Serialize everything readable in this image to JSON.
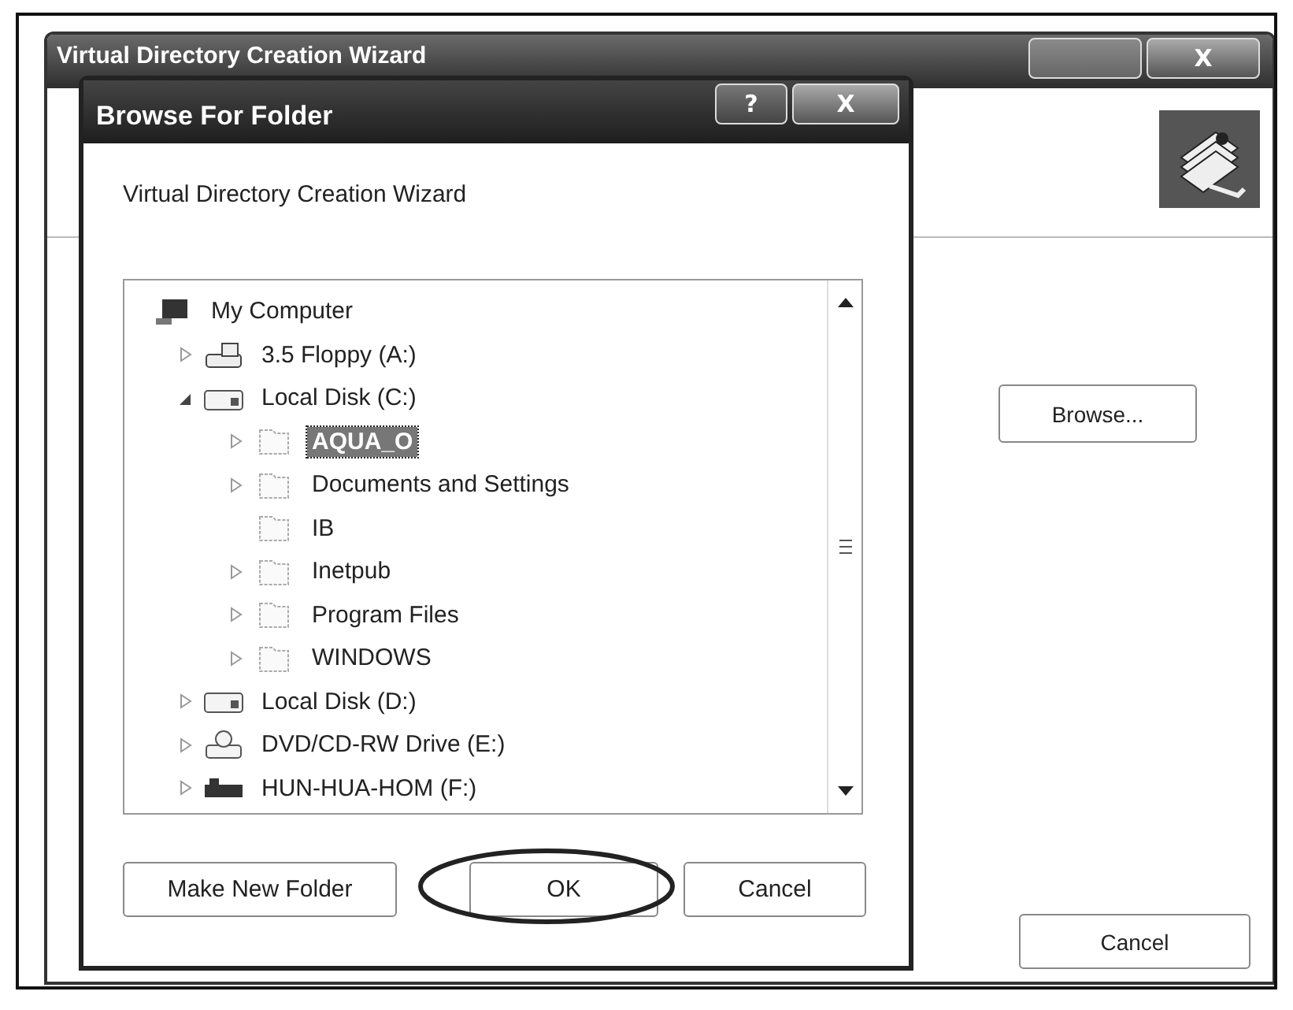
{
  "wizard": {
    "title": "Virtual Directory Creation Wizard",
    "title_buttons": [
      {
        "kind": "blank"
      },
      {
        "kind": "close",
        "label": "X"
      }
    ],
    "browse_button": "Browse...",
    "cancel_button": "Cancel"
  },
  "dialog": {
    "title": "Browse For Folder",
    "title_buttons": [
      {
        "kind": "help",
        "label": "?"
      },
      {
        "kind": "close",
        "label": "X"
      }
    ],
    "description": "Virtual Directory Creation Wizard",
    "tree": [
      {
        "label": "My Computer",
        "kind": "computer",
        "selected": false,
        "children": [
          {
            "label": "3.5 Floppy (A:)",
            "kind": "floppy",
            "expanded": false,
            "selected": false
          },
          {
            "label": "Local Disk (C:)",
            "kind": "drive",
            "expanded": true,
            "selected": false,
            "children": [
              {
                "label": "AQUA_O",
                "kind": "folder",
                "expanded": false,
                "selected": true
              },
              {
                "label": "Documents and Settings",
                "kind": "folder",
                "expanded": false,
                "selected": false
              },
              {
                "label": "IB",
                "kind": "folder",
                "selected": false
              },
              {
                "label": "Inetpub",
                "kind": "folder",
                "expanded": false,
                "selected": false
              },
              {
                "label": "Program Files",
                "kind": "folder",
                "expanded": false,
                "selected": false
              },
              {
                "label": "WINDOWS",
                "kind": "folder",
                "expanded": false,
                "selected": false
              }
            ]
          },
          {
            "label": "Local Disk (D:)",
            "kind": "drive",
            "expanded": false,
            "selected": false
          },
          {
            "label": "DVD/CD-RW Drive (E:)",
            "kind": "dvd",
            "expanded": false,
            "selected": false
          },
          {
            "label": "HUN-HUA-HOM (F:)",
            "kind": "usb",
            "expanded": false,
            "selected": false
          }
        ]
      }
    ],
    "buttons": [
      {
        "label": "Make New Folder",
        "circled": false
      },
      {
        "label": "OK",
        "circled": true
      },
      {
        "label": "Cancel",
        "circled": false
      }
    ]
  }
}
